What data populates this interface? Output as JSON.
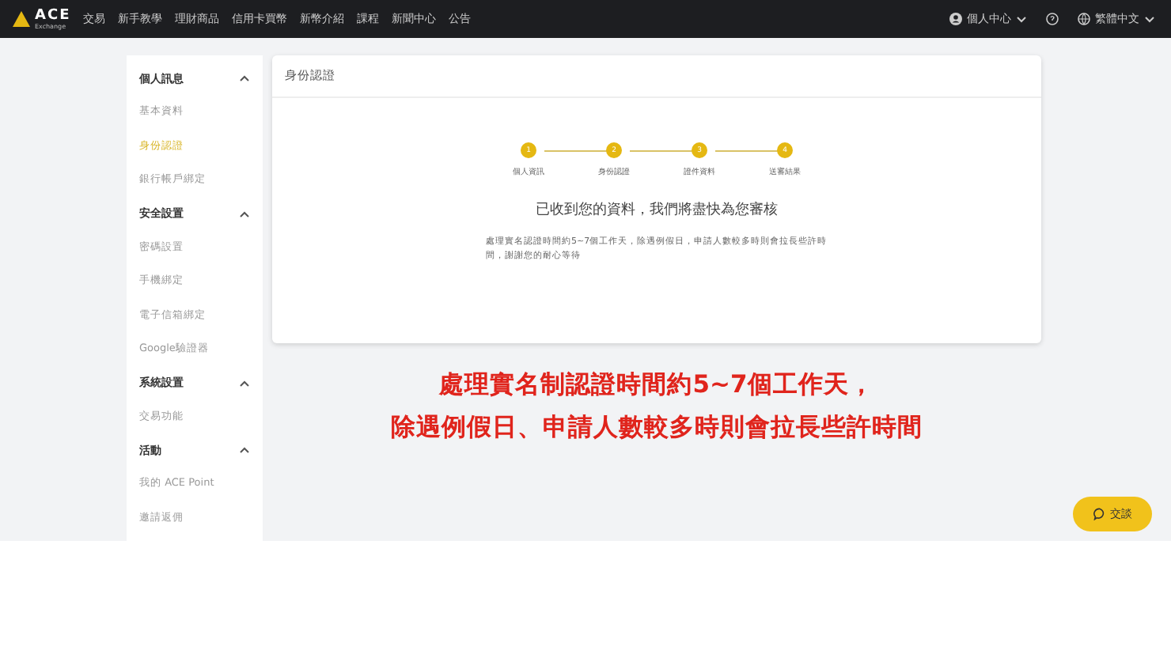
{
  "nav": {
    "logo": {
      "name": "ACE",
      "sub": "Exchange"
    },
    "links": [
      "交易",
      "新手教學",
      "理財商品",
      "信用卡買幣",
      "新幣介紹",
      "課程",
      "新聞中心",
      "公告"
    ],
    "user_menu": "個人中心",
    "language": "繁體中文"
  },
  "sidebar": {
    "sections": [
      {
        "title": "個人訊息",
        "expanded": true,
        "items": [
          {
            "label": "基本資料",
            "selected": false
          },
          {
            "label": "身份認證",
            "selected": true
          },
          {
            "label": "銀行帳戶綁定",
            "selected": false
          }
        ]
      },
      {
        "title": "安全設置",
        "expanded": true,
        "items": [
          {
            "label": "密碼設置",
            "selected": false
          },
          {
            "label": "手機綁定",
            "selected": false
          },
          {
            "label": "電子信箱綁定",
            "selected": false
          },
          {
            "label": "Google驗證器",
            "selected": false
          }
        ]
      },
      {
        "title": "系統設置",
        "expanded": true,
        "items": [
          {
            "label": "交易功能",
            "selected": false
          }
        ]
      },
      {
        "title": "活動",
        "expanded": true,
        "items": [
          {
            "label": "我的 ACE Point",
            "selected": false
          },
          {
            "label": "邀請返佣",
            "selected": false
          }
        ]
      }
    ]
  },
  "card": {
    "title": "身份認證",
    "steps": [
      {
        "number": "1",
        "label": "個人資訊",
        "done": true
      },
      {
        "number": "2",
        "label": "身份認證",
        "done": true
      },
      {
        "number": "3",
        "label": "證件資料",
        "done": true
      },
      {
        "number": "4",
        "label": "送審結果",
        "done": true
      }
    ],
    "heading": "已收到您的資料，我們將盡快為您審核",
    "note": "處理實名認證時間約5~7個工作天，除遇例假日，申請人數較多時則會拉長些許時間，謝謝您的耐心等待"
  },
  "caption": [
    "處理實名制認證時間約5~7個工作天，",
    "除遇例假日、申請人數較多時則會拉長些許時間"
  ],
  "chat_button": "交談"
}
